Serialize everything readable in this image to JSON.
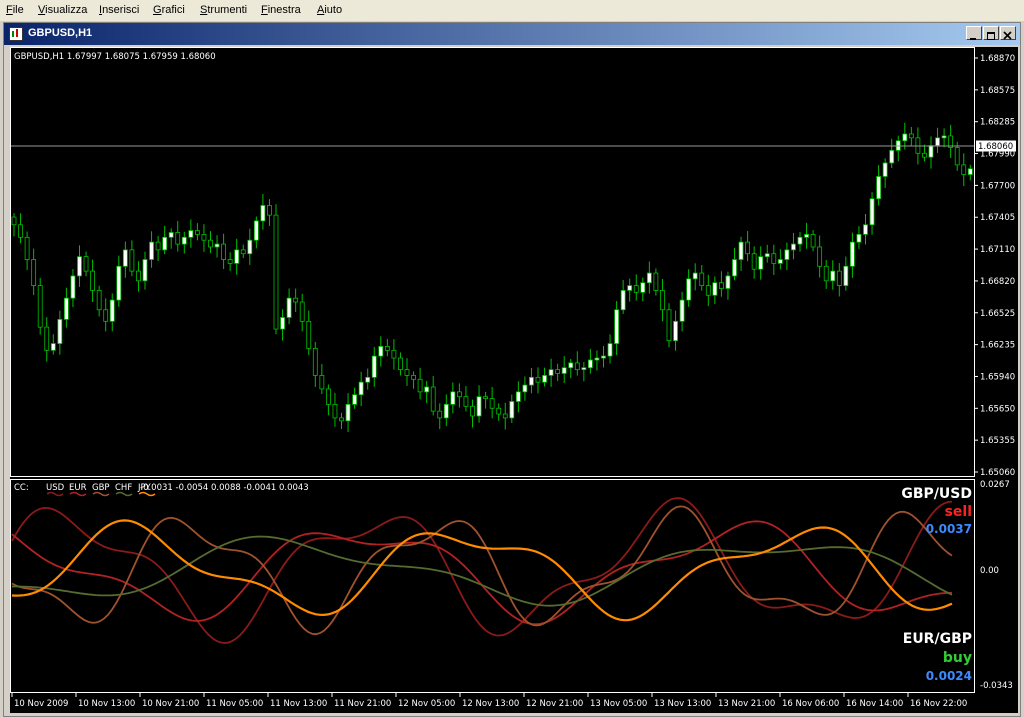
{
  "menu": [
    "File",
    "Visualizza",
    "Inserisci",
    "Grafici",
    "Strumenti",
    "Finestra",
    "Aiuto"
  ],
  "window": {
    "title": "GBPUSD,H1"
  },
  "price_chart": {
    "header": "GBPUSD,H1  1.67997 1.68075 1.67959 1.68060",
    "last_price": "1.68060",
    "y_ticks": [
      "1.68870",
      "1.68575",
      "1.68285",
      "1.67990",
      "1.67700",
      "1.67405",
      "1.67110",
      "1.66820",
      "1.66525",
      "1.66235",
      "1.65940",
      "1.65650",
      "1.65355",
      "1.65060"
    ]
  },
  "indicator": {
    "header_prefix": "CC:",
    "legend": [
      "USD",
      "EUR",
      "GBP",
      "CHF",
      "JPY"
    ],
    "legend_colors": [
      "#8b1a1a",
      "#b22222",
      "#a0522d",
      "#556b2f",
      "#ff8c00"
    ],
    "header_values": "-0.0031 -0.0054 0.0088 -0.0041 0.0043",
    "y_ticks": [
      "0.0267",
      "0.00",
      "-0.0343"
    ],
    "pair1": {
      "name": "GBP/USD",
      "signal": "sell",
      "value": "0.0037",
      "signal_color": "#ff2020"
    },
    "pair2": {
      "name": "EUR/GBP",
      "signal": "buy",
      "value": "0.0024",
      "signal_color": "#32cd32"
    },
    "value_color": "#3b8bff"
  },
  "x_ticks": [
    "10 Nov 2009",
    "10 Nov 13:00",
    "10 Nov 21:00",
    "11 Nov 05:00",
    "11 Nov 13:00",
    "11 Nov 21:00",
    "12 Nov 05:00",
    "12 Nov 13:00",
    "12 Nov 21:00",
    "13 Nov 05:00",
    "13 Nov 13:00",
    "13 Nov 21:00",
    "16 Nov 06:00",
    "16 Nov 14:00",
    "16 Nov 22:00"
  ],
  "colors": {
    "bull": "#ffffff",
    "bear": "#000000",
    "wick": "#00c000",
    "axis": "#ffffff",
    "hline": "#999999"
  },
  "chart_data": {
    "type": "candlestick",
    "y_range": [
      1.6492,
      1.6901
    ],
    "close": [
      1.6748,
      1.6735,
      1.6712,
      1.6685,
      1.6642,
      1.6618,
      1.6625,
      1.665,
      1.6672,
      1.6695,
      1.6715,
      1.67,
      1.668,
      1.666,
      1.6648,
      1.667,
      1.6705,
      1.6722,
      1.67,
      1.669,
      1.6712,
      1.673,
      1.6722,
      1.6735,
      1.674,
      1.6728,
      1.6735,
      1.6742,
      1.6738,
      1.6732,
      1.6725,
      1.6728,
      1.6712,
      1.6708,
      1.6722,
      1.6718,
      1.6732,
      1.6752,
      1.6768,
      1.6758,
      1.664,
      1.6652,
      1.6672,
      1.6668,
      1.6648,
      1.662,
      1.6592,
      1.6578,
      1.6562,
      1.6548,
      1.6545,
      1.6562,
      1.6572,
      1.6585,
      1.659,
      1.6612,
      1.6622,
      1.6618,
      1.661,
      1.6598,
      1.6592,
      1.6588,
      1.6575,
      1.658,
      1.6555,
      1.6548,
      1.6562,
      1.6575,
      1.657,
      1.656,
      1.655,
      1.657,
      1.6568,
      1.6558,
      1.6552,
      1.6548,
      1.6565,
      1.6575,
      1.6582,
      1.659,
      1.6585,
      1.6592,
      1.6598,
      1.6594,
      1.66,
      1.6605,
      1.6598,
      1.66,
      1.6608,
      1.661,
      1.6612,
      1.6625,
      1.666,
      1.668,
      1.6685,
      1.6678,
      1.6688,
      1.6698,
      1.668,
      1.666,
      1.6628,
      1.6648,
      1.667,
      1.6692,
      1.6698,
      1.6685,
      1.6675,
      1.6688,
      1.6682,
      1.6695,
      1.6712,
      1.673,
      1.6718,
      1.6702,
      1.6715,
      1.6718,
      1.6708,
      1.6712,
      1.6722,
      1.6728,
      1.6735,
      1.6738,
      1.6725,
      1.6705,
      1.669,
      1.67,
      1.6685,
      1.6705,
      1.673,
      1.6738,
      1.6748,
      1.6775,
      1.6798,
      1.6812,
      1.6825,
      1.6835,
      1.6842,
      1.6838,
      1.6822,
      1.6818,
      1.683,
      1.6838,
      1.684,
      1.6828,
      1.681,
      1.68,
      1.6806
    ],
    "note": ""
  }
}
